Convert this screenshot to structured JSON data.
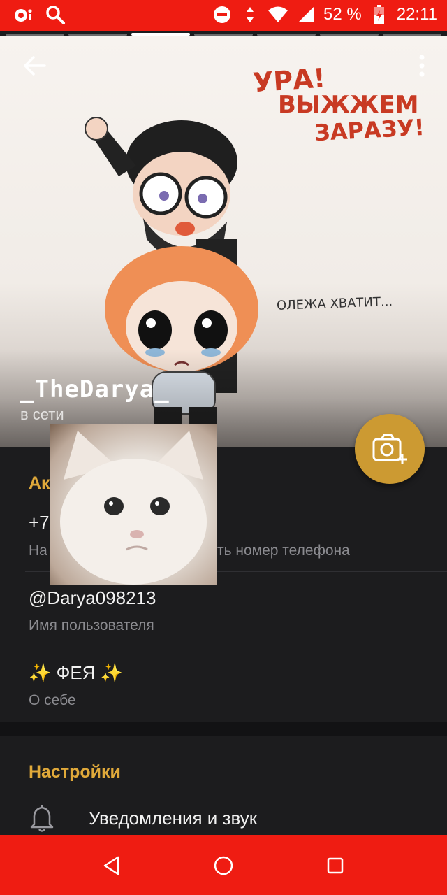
{
  "status_bar": {
    "battery_percent": "52 %",
    "time": "22:11",
    "icons": [
      "camera-notification-icon",
      "search-icon",
      "do-not-disturb-icon",
      "data-arrows-icon",
      "wifi-icon",
      "signal-icon",
      "battery-icon"
    ]
  },
  "stories": {
    "segments": 7,
    "active_index": 2
  },
  "header": {
    "back_icon": "arrow-left-icon",
    "menu_icon": "more-vertical-icon",
    "photo_text_1": "УРА!",
    "photo_text_2": "ВЫЖЖЕМ",
    "photo_text_3": "ЗАРАЗУ!",
    "photo_text_4": "ОЛЕЖА ХВАТИТ...",
    "name": "_TheDarya_",
    "status": "в сети",
    "fab_icon": "add-photo-icon"
  },
  "account": {
    "title": "Ак",
    "phone_value": "+7",
    "phone_label_left": "На",
    "phone_label_right": "ть номер телефона",
    "username_value": "@Darya098213",
    "username_label": "Имя пользователя",
    "bio_value": "✨ ФЕЯ ✨",
    "bio_label": "О себе"
  },
  "settings": {
    "title": "Настройки",
    "items": [
      {
        "label": "Уведомления и звук",
        "icon": "bell-icon"
      }
    ]
  },
  "nav": {
    "back_icon": "nav-back-triangle-icon",
    "home_icon": "nav-home-circle-icon",
    "recents_icon": "nav-recents-square-icon"
  },
  "colors": {
    "accent": "#e0a93a",
    "fab": "#cc9a32",
    "system_bar": "#ef1c12",
    "background": "#1c1c1e"
  }
}
